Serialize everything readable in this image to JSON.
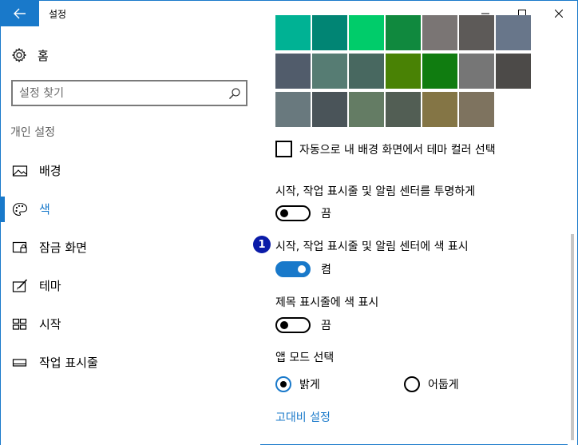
{
  "window": {
    "title": "설정"
  },
  "sidebar": {
    "home_label": "홈",
    "search_placeholder": "설정 찾기",
    "section_label": "개인 설정",
    "items": [
      {
        "label": "배경",
        "icon": "picture-icon",
        "active": false
      },
      {
        "label": "색",
        "icon": "palette-icon",
        "active": true
      },
      {
        "label": "잠금 화면",
        "icon": "lock-screen-icon",
        "active": false
      },
      {
        "label": "테마",
        "icon": "theme-brush-icon",
        "active": false
      },
      {
        "label": "시작",
        "icon": "start-grid-icon",
        "active": false
      },
      {
        "label": "작업 표시줄",
        "icon": "taskbar-icon",
        "active": false
      }
    ]
  },
  "content": {
    "swatch_rows": [
      [
        "#00b294",
        "#018574",
        "#00cc6a",
        "#10893e",
        "#7a7574",
        "#5d5a58",
        "#68768a"
      ],
      [
        "#515c6b",
        "#567c73",
        "#486860",
        "#498205",
        "#107c10",
        "#767676",
        "#4c4a48"
      ],
      [
        "#69797e",
        "#4a5459",
        "#647c64",
        "#525e54",
        "#847545",
        "#7e735f"
      ]
    ],
    "auto_color_checkbox": {
      "label": "자동으로 내 배경 화면에서 테마 컬러 선택",
      "checked": false
    },
    "transparency": {
      "label": "시작, 작업 표시줄 및 알림 센터를 투명하게",
      "state": "끔",
      "on": false
    },
    "start_color": {
      "label": "시작, 작업 표시줄 및 알림 센터에 색 표시",
      "state": "켬",
      "on": true,
      "badge": "1"
    },
    "titlebar_color": {
      "label": "제목 표시줄에 색 표시",
      "state": "끔",
      "on": false
    },
    "app_mode": {
      "label": "앱 모드 선택",
      "options": [
        {
          "label": "밝게",
          "checked": true
        },
        {
          "label": "어둡게",
          "checked": false
        }
      ]
    },
    "high_contrast_link": "고대비 설정"
  },
  "colors": {
    "accent": "#1979ca",
    "badge": "#0a1ba8"
  }
}
